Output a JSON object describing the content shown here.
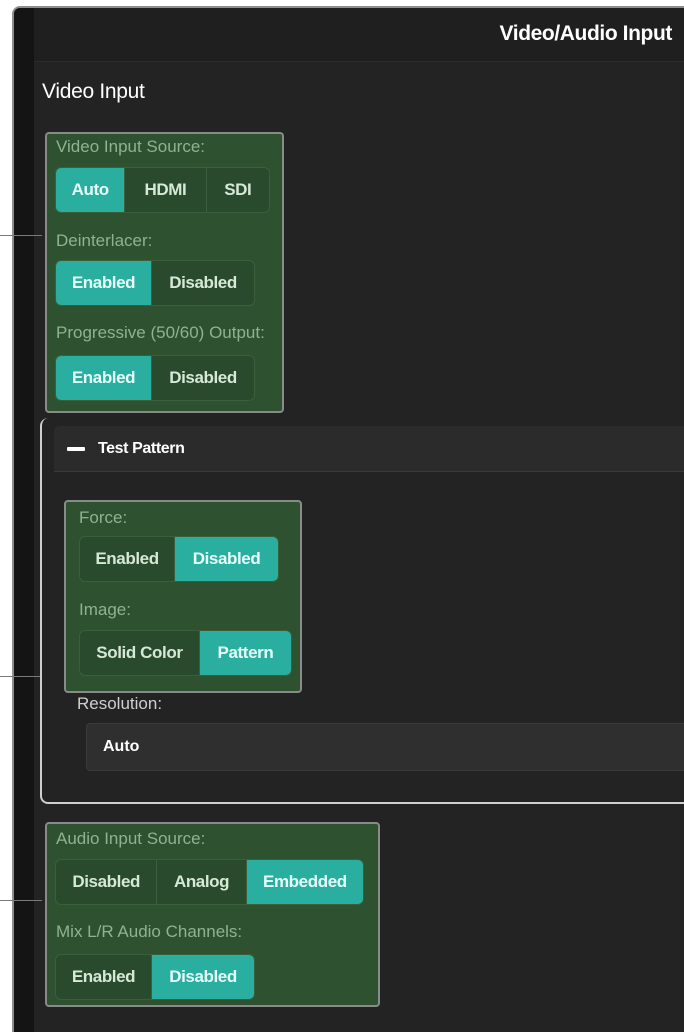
{
  "header": {
    "title": "Video/Audio Input"
  },
  "video_input": {
    "section_title": "Video Input",
    "source": {
      "label": "Video Input Source:",
      "options": [
        "Auto",
        "HDMI",
        "SDI"
      ],
      "selected": "Auto"
    },
    "deinterlacer": {
      "label": "Deinterlacer:",
      "options": [
        "Enabled",
        "Disabled"
      ],
      "selected": "Enabled"
    },
    "progressive": {
      "label": "Progressive (50/60) Output:",
      "options": [
        "Enabled",
        "Disabled"
      ],
      "selected": "Enabled"
    }
  },
  "test_pattern": {
    "title": "Test Pattern",
    "toggle_icon": "minus-icon",
    "force": {
      "label": "Force:",
      "options": [
        "Enabled",
        "Disabled"
      ],
      "selected": "Disabled"
    },
    "image": {
      "label": "Image:",
      "options": [
        "Solid Color",
        "Pattern"
      ],
      "selected": "Pattern"
    },
    "resolution": {
      "label": "Resolution:",
      "value": "Auto"
    }
  },
  "audio_input": {
    "source": {
      "label": "Audio Input Source:",
      "options": [
        "Disabled",
        "Analog",
        "Embedded"
      ],
      "selected": "Embedded"
    },
    "mix": {
      "label": "Mix L/R Audio Channels:",
      "options": [
        "Enabled",
        "Disabled"
      ],
      "selected": "Disabled"
    }
  },
  "colors": {
    "accent": "#2aaea0",
    "group_bg": "#2e5230",
    "panel_bg": "#232323",
    "header_bg": "#1f1f1f"
  }
}
